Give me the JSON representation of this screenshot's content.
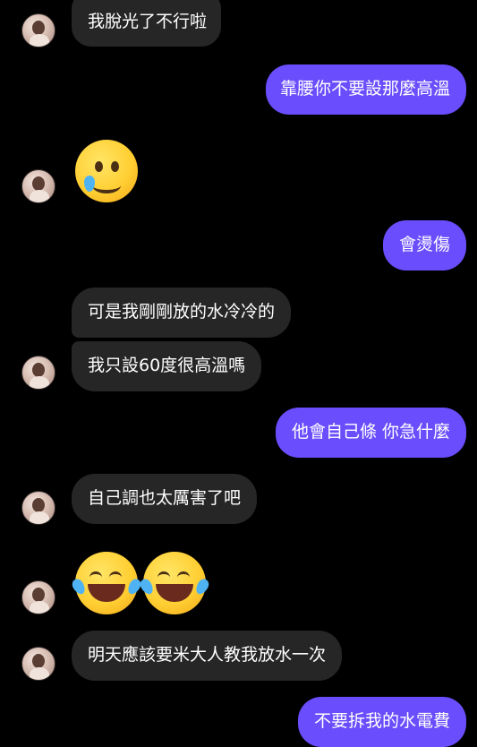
{
  "messages": {
    "m1": "我脫光了不行啦",
    "m2": "靠腰你不要設那麼高溫",
    "m3": "🥲",
    "m4": "會燙傷",
    "m5": "可是我剛剛放的水冷冷的",
    "m6": "我只設60度很高溫嗎",
    "m7": "他會自己條 你急什麼",
    "m8": "自己調也太厲害了吧",
    "m9": "😂😂",
    "m10": "明天應該要米大人教我放水一次",
    "m11": "不要拆我的水電費"
  },
  "colors": {
    "background": "#000000",
    "incoming_bubble": "#262626",
    "outgoing_bubble": "#6a4dfc"
  },
  "icons": {
    "avatar": "contact-avatar",
    "emoji_tear": "smiling-face-with-tear-emoji",
    "emoji_laugh": "face-with-tears-of-joy-emoji"
  }
}
